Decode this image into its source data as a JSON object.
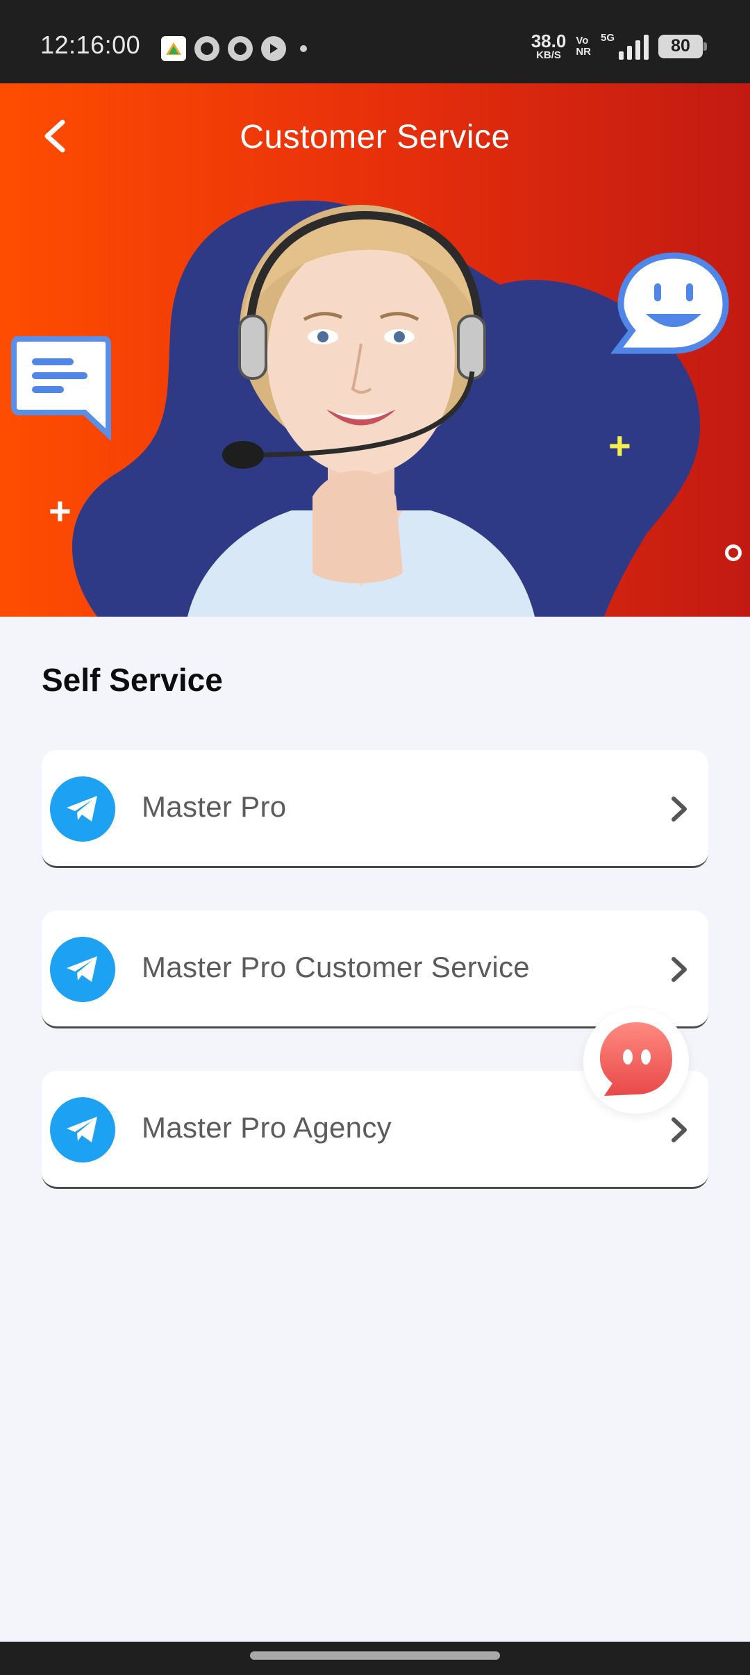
{
  "status_bar": {
    "time": "12:16:00",
    "net_speed_value": "38.0",
    "net_speed_unit": "KB/S",
    "volte_top": "Vo",
    "volte_bottom": "NR",
    "network_type": "5G",
    "battery": "80",
    "icons": [
      "app-notification-icon",
      "whatsapp-icon",
      "recording-icon",
      "play-icon"
    ]
  },
  "header": {
    "title": "Customer Service",
    "back_icon": "chevron-left-icon"
  },
  "hero": {
    "image": "customer-service-agent-illustration"
  },
  "main": {
    "section_title": "Self Service",
    "items": [
      {
        "label": "Master Pro",
        "icon": "telegram-icon"
      },
      {
        "label": "Master Pro Customer Service",
        "icon": "telegram-icon"
      },
      {
        "label": "Master Pro Agency",
        "icon": "telegram-icon"
      }
    ]
  },
  "floating": {
    "icon": "chat-bubble-icon"
  },
  "colors": {
    "header_gradient_start": "#ff4d00",
    "header_gradient_end": "#c21a12",
    "blob": "#2f3a86",
    "telegram_blue": "#1da1f2",
    "page_background": "#f4f5fb"
  }
}
